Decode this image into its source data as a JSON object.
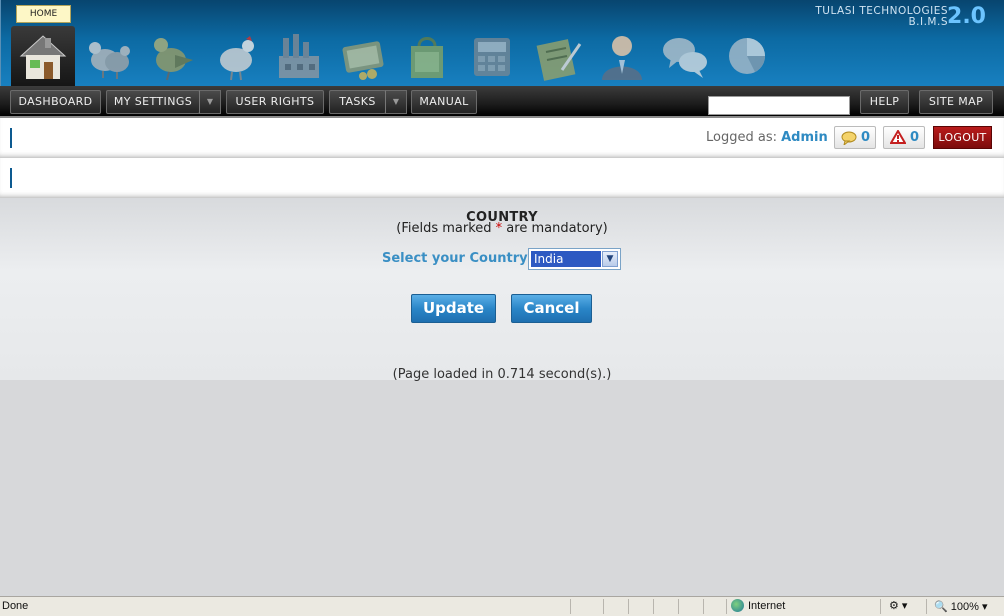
{
  "header": {
    "home_label": "HOME",
    "brand_line1": "TULASI TECHNOLOGIES",
    "brand_line2": "B.I.M.S",
    "version": "2.0",
    "module_icons": [
      "house-icon",
      "hens-icon",
      "bird-icon",
      "hen-icon",
      "factory-icon",
      "wallet-icon",
      "shopping-bag-icon",
      "calculator-icon",
      "notepad-icon",
      "user-icon",
      "chat-icon",
      "pie-chart-icon"
    ]
  },
  "menu": {
    "dashboard": "DASHBOARD",
    "my_settings": "MY SETTINGS",
    "user_rights": "USER RIGHTS",
    "tasks": "TASKS",
    "manual": "MANUAL",
    "search_value": "",
    "help": "HELP",
    "site_map": "SITE MAP"
  },
  "infobar": {
    "logged_as": "Logged as:",
    "user": "Admin",
    "messages_count": "0",
    "alerts_count": "0",
    "logout": "LOGOUT"
  },
  "form": {
    "title": "COUNTRY",
    "subtitle_pre": "(Fields marked ",
    "subtitle_star": "*",
    "subtitle_post": " are mandatory)",
    "country_label": "Select your Country",
    "required_mark": "*",
    "country_value": "India",
    "update": "Update",
    "cancel": "Cancel",
    "load_time": "(Page loaded in 0.714 second(s).)"
  },
  "statusbar": {
    "status": "Done",
    "zone": "Internet",
    "zoom": "100%"
  },
  "colors": {
    "header_blue": "#0c6aa3",
    "link_blue": "#2e8ac2",
    "logout_red": "#b91c1c",
    "button_blue": "#2a86c8"
  }
}
